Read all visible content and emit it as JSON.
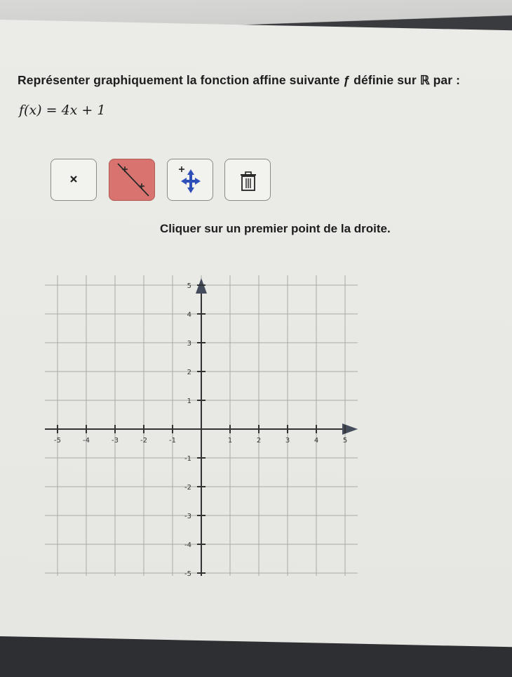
{
  "question": {
    "text": "Représenter graphiquement la fonction affine suivante ƒ définie sur ℝ par :",
    "formula": "f(x) = 4x + 1"
  },
  "toolbar": {
    "tools": [
      {
        "name": "point-tool",
        "icon": "cross-icon",
        "active": false
      },
      {
        "name": "line-tool",
        "icon": "line-through-points-icon",
        "active": true
      },
      {
        "name": "move-tool",
        "icon": "move-arrows-icon",
        "active": false
      },
      {
        "name": "delete-tool",
        "icon": "trash-icon",
        "active": false
      }
    ],
    "active_color": "#d9736f"
  },
  "instruction": "Cliquer sur un premier point de la droite.",
  "grid": {
    "x_range": [
      -5,
      5
    ],
    "y_range": [
      -5,
      5
    ],
    "x_ticks": [
      "-5",
      "-4",
      "-3",
      "-2",
      "-1",
      "1",
      "2",
      "3",
      "4",
      "5"
    ],
    "y_ticks": [
      "5",
      "4",
      "3",
      "2",
      "1",
      "-1",
      "-2",
      "-3",
      "-4",
      "-5"
    ],
    "grid_visible": true
  }
}
